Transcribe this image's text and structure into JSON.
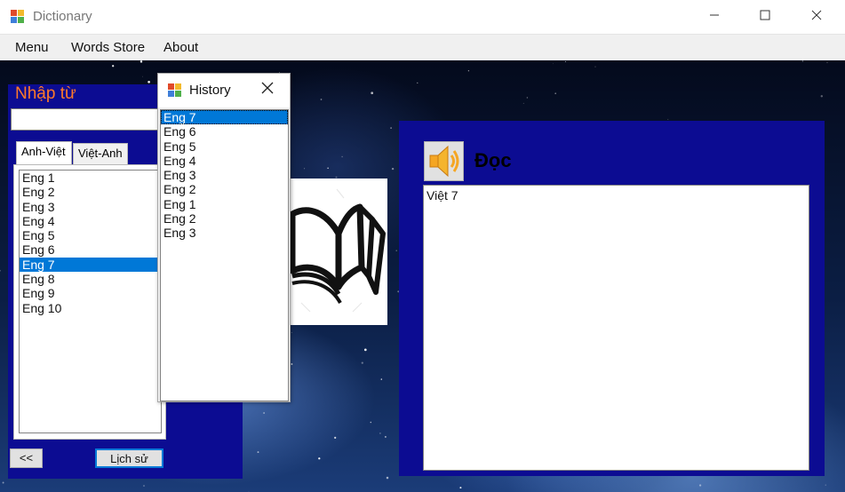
{
  "window": {
    "title": "Dictionary"
  },
  "menu": {
    "items": [
      "Menu",
      "Words Store",
      "About"
    ]
  },
  "left_panel": {
    "input_label": "Nhập từ",
    "search_value": "",
    "tabs": [
      {
        "label": "Anh-Việt",
        "active": true
      },
      {
        "label": "Việt-Anh",
        "active": false
      }
    ],
    "words": [
      "Eng 1",
      "Eng 2",
      "Eng 3",
      "Eng 4",
      "Eng 5",
      "Eng 6",
      "Eng 7",
      "Eng 8",
      "Eng 9",
      "Eng 10"
    ],
    "selected_word": "Eng 7",
    "back_button": "<<",
    "history_button": "Lịch sử"
  },
  "history_window": {
    "title": "History",
    "items": [
      "Eng 7",
      "Eng 6",
      "Eng 5",
      "Eng 4",
      "Eng 3",
      "Eng 2",
      "Eng 1",
      "Eng 2",
      "Eng 3"
    ],
    "selected_index": 0
  },
  "right_panel": {
    "read_label": "Đọc",
    "meaning": "Việt 7"
  },
  "icons": {
    "app": "app-icon",
    "speaker": "speaker-icon",
    "book": "open-book-icon"
  },
  "colors": {
    "panel_blue": "#0c0c92",
    "label_orange": "#ff7a2a",
    "selection_blue": "#0078d7",
    "speaker_orange": "#f5a623"
  }
}
